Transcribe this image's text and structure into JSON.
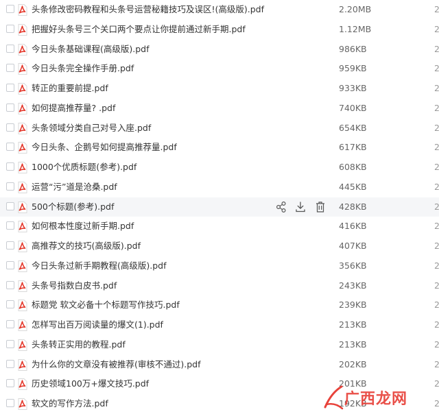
{
  "files": [
    {
      "name": "头条修改密码教程和头条号运营秘籍技巧及误区!(高级版).pdf",
      "size": "2.20MB",
      "date": "2"
    },
    {
      "name": "把握好头条号三个关口两个要点让你提前通过新手期.pdf",
      "size": "1.12MB",
      "date": "2"
    },
    {
      "name": "今日头条基础课程(高级版).pdf",
      "size": "986KB",
      "date": "2"
    },
    {
      "name": "今日头条完全操作手册.pdf",
      "size": "959KB",
      "date": "2"
    },
    {
      "name": "转正的重要前提.pdf",
      "size": "933KB",
      "date": "2"
    },
    {
      "name": "如何提高推荐量? .pdf",
      "size": "740KB",
      "date": "2"
    },
    {
      "name": "头条领域分类自己对号入座.pdf",
      "size": "654KB",
      "date": "2"
    },
    {
      "name": "今日头条、企鹅号如何提高推荐量.pdf",
      "size": "617KB",
      "date": "2"
    },
    {
      "name": "1000个优质标题(参考).pdf",
      "size": "608KB",
      "date": "2"
    },
    {
      "name": "运营“污”道是沧桑.pdf",
      "size": "445KB",
      "date": "2"
    },
    {
      "name": "500个标题(参考).pdf",
      "size": "428KB",
      "date": "2"
    },
    {
      "name": "如何根本性度过新手期.pdf",
      "size": "416KB",
      "date": "2"
    },
    {
      "name": "高推荐文的技巧(高级版).pdf",
      "size": "407KB",
      "date": "2"
    },
    {
      "name": "今日头条过新手期教程(高级版).pdf",
      "size": "356KB",
      "date": "2"
    },
    {
      "name": "头条号指数白皮书.pdf",
      "size": "243KB",
      "date": "2"
    },
    {
      "name": "标题党 软文必备十个标题写作技巧.pdf",
      "size": "239KB",
      "date": "2"
    },
    {
      "name": "怎样写出百万阅读量的爆文(1).pdf",
      "size": "213KB",
      "date": "2"
    },
    {
      "name": "头条转正实用的教程.pdf",
      "size": "213KB",
      "date": "2"
    },
    {
      "name": "为什么你的文章没有被推荐(审核不通过).pdf",
      "size": "202KB",
      "date": "2"
    },
    {
      "name": "历史领域100万+爆文技巧.pdf",
      "size": "201KB",
      "date": "2"
    },
    {
      "name": "软文的写作方法.pdf",
      "size": "192KB",
      "date": "2"
    }
  ],
  "hover_row_index": 10,
  "row_actions": {
    "share": "share-icon",
    "download": "download-icon",
    "delete": "trash-icon"
  },
  "watermark": {
    "text": "广西龙网"
  },
  "colors": {
    "pdf_red": "#e4392c",
    "hover_bg": "#f5f6f8",
    "watermark": "#e8423a"
  }
}
